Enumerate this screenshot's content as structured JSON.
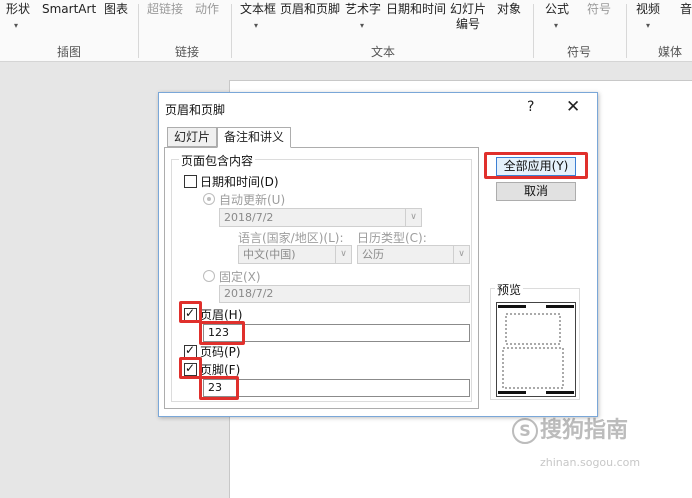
{
  "ribbon": {
    "items": [
      {
        "label": "形状",
        "disabled": false
      },
      {
        "label": "SmartArt",
        "disabled": false
      },
      {
        "label": "图表",
        "disabled": false
      },
      {
        "label": "超链接",
        "disabled": true
      },
      {
        "label": "动作",
        "disabled": true
      },
      {
        "label": "文本框",
        "disabled": false
      },
      {
        "label": "页眉和页脚",
        "disabled": false
      },
      {
        "label": "艺术字",
        "disabled": false
      },
      {
        "label": "日期和时间",
        "disabled": false
      },
      {
        "label": "幻灯片",
        "label2": "编号",
        "disabled": false
      },
      {
        "label": "对象",
        "disabled": false
      },
      {
        "label": "公式",
        "disabled": false
      },
      {
        "label": "符号",
        "disabled": true
      },
      {
        "label": "视频",
        "disabled": false
      },
      {
        "label": "音",
        "disabled": false
      }
    ],
    "groups": [
      "插图",
      "链接",
      "文本",
      "符号",
      "媒体"
    ]
  },
  "dialog": {
    "title": "页眉和页脚",
    "help": "?",
    "close": "✕",
    "tabs": [
      "幻灯片",
      "备注和讲义"
    ],
    "active_tab": "备注和讲义",
    "section_title": "页面包含内容",
    "datetime": {
      "label": "日期和时间(D)",
      "checked": false,
      "auto_label": "自动更新(U)",
      "auto_value": "2018/7/2",
      "language_label": "语言(国家/地区)(L):",
      "language_value": "中文(中国)",
      "calendar_label": "日历类型(C):",
      "calendar_value": "公历",
      "fixed_label": "固定(X)",
      "fixed_value": "2018/7/2"
    },
    "header": {
      "label": "页眉(H)",
      "checked": true,
      "value": "123"
    },
    "page_number": {
      "label": "页码(P)",
      "checked": true
    },
    "footer": {
      "label": "页脚(F)",
      "checked": true,
      "value": "23"
    },
    "apply_all_button": "全部应用(Y)",
    "cancel_button": "取消",
    "preview_label": "预览"
  },
  "watermark": {
    "text": "搜狗指南",
    "url": "zhinan.sogou.com"
  },
  "colors": {
    "highlight": "#e0302c",
    "dialog_border": "#7aa7d8",
    "default_button_border": "#3c7fd3"
  }
}
